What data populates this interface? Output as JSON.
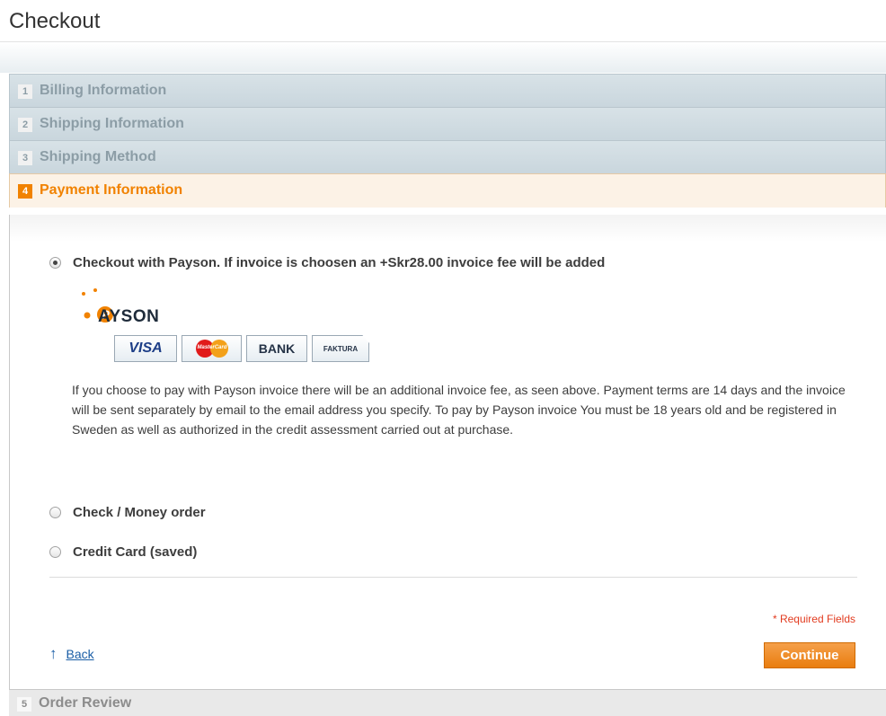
{
  "page": {
    "title": "Checkout"
  },
  "steps": [
    {
      "num": "1",
      "label": "Billing Information"
    },
    {
      "num": "2",
      "label": "Shipping Information"
    },
    {
      "num": "3",
      "label": "Shipping Method"
    },
    {
      "num": "4",
      "label": "Payment Information"
    },
    {
      "num": "5",
      "label": "Order Review"
    }
  ],
  "active_step": 4,
  "payment": {
    "methods": [
      {
        "label": "Checkout with Payson. If invoice is choosen an +Skr28.00 invoice fee will be added",
        "checked": true
      },
      {
        "label": "Check / Money order",
        "checked": false
      },
      {
        "label": "Credit Card (saved)",
        "checked": false
      }
    ],
    "payson": {
      "logo_text": "AYSON",
      "badges": {
        "visa": "VISA",
        "mastercard": "MasterCard",
        "bank": "BANK",
        "faktura": "FAKTURA"
      },
      "description": "If you choose to pay with Payson invoice there will be an additional invoice fee, as seen above. Payment terms are 14 days and the invoice will be sent separately by email to the email address you specify. To pay by Payson invoice You must be 18 years old and be registered in Sweden as well as authorized in the credit assessment carried out at purchase."
    }
  },
  "form": {
    "required_note": "* Required Fields",
    "back_label": "Back",
    "back_arrow": "↑",
    "continue_label": "Continue"
  },
  "colors": {
    "accent": "#f18200",
    "link": "#1a5ea6",
    "required": "#e23b1f",
    "step_bg": "#c9d6dd"
  },
  "icons": {
    "back": "arrow-up-icon",
    "payson": "payson-logo-icon"
  }
}
